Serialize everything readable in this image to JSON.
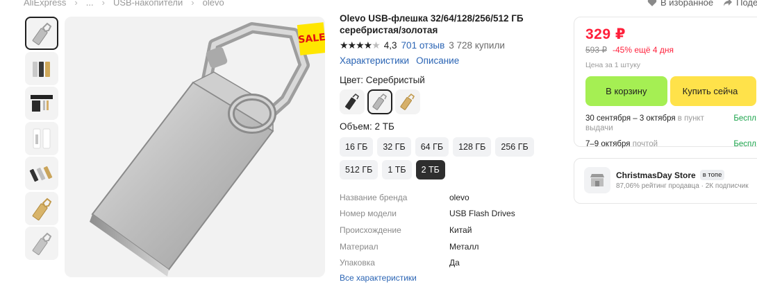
{
  "breadcrumb": {
    "items": [
      "AliExpress",
      "...",
      "USB-накопители",
      "olevo"
    ]
  },
  "header": {
    "favorite_label": "В избранное",
    "share_label": "Подел"
  },
  "gallery": {
    "thumbnails": [
      "silver-drive",
      "three-colors",
      "product-box",
      "white-packs",
      "multi-color",
      "gold-drive",
      "silver-drive-small"
    ],
    "active_index": 0,
    "sale_badge": "SALE"
  },
  "product": {
    "title": "Olevo USB-флешка 32/64/128/256/512 ГБ серебристая/золотая",
    "rating": "4,3",
    "stars": 4.3,
    "reviews": "701 отзыв",
    "purchases": "3 728 купили",
    "tabs": [
      "Характеристики",
      "Описание"
    ],
    "color_label": "Цвет: Серебристый",
    "colors": [
      "black",
      "silver",
      "gold"
    ],
    "active_color": 1,
    "volume_label": "Объем: 2 ТБ",
    "sizes": [
      "16 ГБ",
      "32 ГБ",
      "64 ГБ",
      "128 ГБ",
      "256 ГБ",
      "512 ГБ",
      "1 ТБ",
      "2 ТБ"
    ],
    "active_size": 7,
    "specs": [
      {
        "key": "Название бренда",
        "value": "olevo"
      },
      {
        "key": "Номер модели",
        "value": "USB Flash Drives"
      },
      {
        "key": "Происхождение",
        "value": "Китай"
      },
      {
        "key": "Материал",
        "value": "Металл"
      },
      {
        "key": "Упаковка",
        "value": "Да"
      }
    ],
    "all_specs_link": "Все характеристики"
  },
  "buybox": {
    "price": "329 ₽",
    "old_price": "593 ₽",
    "discount": "-45% ещё 4 дня",
    "per_unit": "Цена за 1 штуку",
    "cart_button": "В корзину",
    "buy_button": "Купить сейча",
    "delivery": [
      {
        "date": "30 сентября – 3 октября",
        "method": "в пункт выдачи",
        "cost": "Беспл"
      },
      {
        "date": "7–9 октября",
        "method": "почтой",
        "cost": "Беспл"
      }
    ]
  },
  "store": {
    "name": "ChristmasDay Store",
    "badge": "в топе",
    "rating_text": "87,06% рейтинг продавца",
    "separator": "·",
    "subscribers": "2К подписчик"
  },
  "colors": {
    "price_red": "#ff1f3a",
    "link_blue": "#2a64b4",
    "cart_green": "#a5ef53",
    "buy_yellow": "#ffe24a",
    "free_green": "#1aa34a"
  }
}
